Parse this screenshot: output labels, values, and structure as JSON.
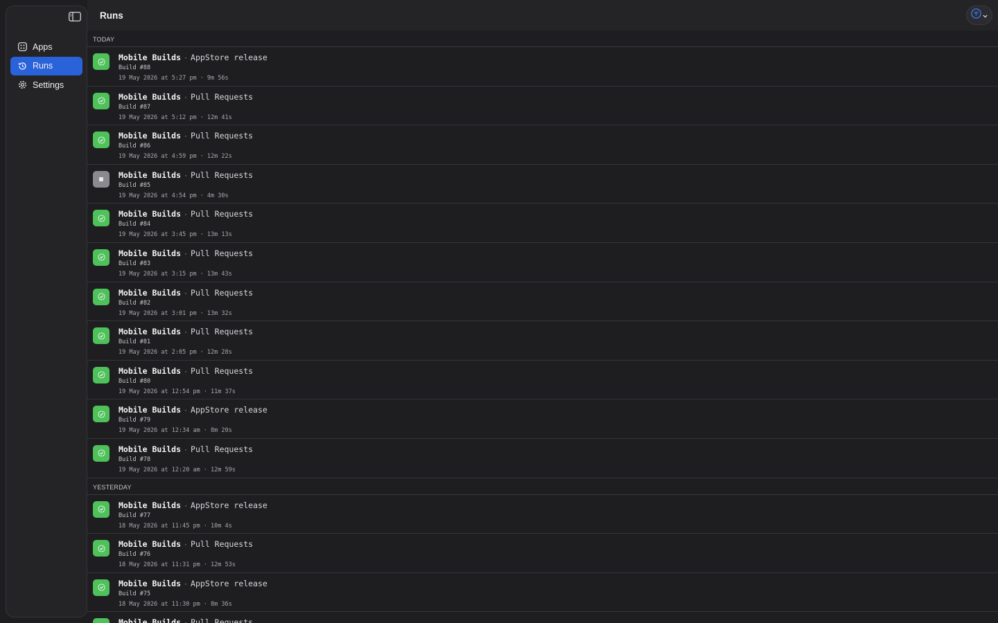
{
  "sidebar": {
    "items": [
      {
        "label": "Apps",
        "icon": "apps-icon"
      },
      {
        "label": "Runs",
        "icon": "history-icon",
        "active": true
      },
      {
        "label": "Settings",
        "icon": "gear-icon"
      }
    ]
  },
  "header": {
    "title": "Runs"
  },
  "colors": {
    "accent": "#2962d9",
    "success": "#4fc15a",
    "cancelled": "#8a8a8f"
  },
  "sections": [
    {
      "label": "TODAY",
      "runs": [
        {
          "app": "Mobile Builds",
          "sep": "·",
          "workflow": "AppStore release",
          "build": "Build #88",
          "meta": "19 May 2026 at 5:27 pm · 9m 56s",
          "status": "success"
        },
        {
          "app": "Mobile Builds",
          "sep": "·",
          "workflow": "Pull Requests",
          "build": "Build #87",
          "meta": "19 May 2026 at 5:12 pm · 12m 41s",
          "status": "success"
        },
        {
          "app": "Mobile Builds",
          "sep": "·",
          "workflow": "Pull Requests",
          "build": "Build #86",
          "meta": "19 May 2026 at 4:59 pm · 12m 22s",
          "status": "success"
        },
        {
          "app": "Mobile Builds",
          "sep": "·",
          "workflow": "Pull Requests",
          "build": "Build #85",
          "meta": "19 May 2026 at 4:54 pm · 4m 30s",
          "status": "cancelled"
        },
        {
          "app": "Mobile Builds",
          "sep": "·",
          "workflow": "Pull Requests",
          "build": "Build #84",
          "meta": "19 May 2026 at 3:45 pm · 13m 13s",
          "status": "success"
        },
        {
          "app": "Mobile Builds",
          "sep": "·",
          "workflow": "Pull Requests",
          "build": "Build #83",
          "meta": "19 May 2026 at 3:15 pm · 13m 43s",
          "status": "success"
        },
        {
          "app": "Mobile Builds",
          "sep": "·",
          "workflow": "Pull Requests",
          "build": "Build #82",
          "meta": "19 May 2026 at 3:01 pm · 13m 32s",
          "status": "success"
        },
        {
          "app": "Mobile Builds",
          "sep": "·",
          "workflow": "Pull Requests",
          "build": "Build #81",
          "meta": "19 May 2026 at 2:05 pm · 12m 28s",
          "status": "success"
        },
        {
          "app": "Mobile Builds",
          "sep": "·",
          "workflow": "Pull Requests",
          "build": "Build #80",
          "meta": "19 May 2026 at 12:54 pm · 11m 37s",
          "status": "success"
        },
        {
          "app": "Mobile Builds",
          "sep": "·",
          "workflow": "AppStore release",
          "build": "Build #79",
          "meta": "19 May 2026 at 12:34 am · 8m 20s",
          "status": "success"
        },
        {
          "app": "Mobile Builds",
          "sep": "·",
          "workflow": "Pull Requests",
          "build": "Build #78",
          "meta": "19 May 2026 at 12:20 am · 12m 59s",
          "status": "success"
        }
      ]
    },
    {
      "label": "YESTERDAY",
      "runs": [
        {
          "app": "Mobile Builds",
          "sep": "·",
          "workflow": "AppStore release",
          "build": "Build #77",
          "meta": "18 May 2026 at 11:45 pm · 10m 4s",
          "status": "success"
        },
        {
          "app": "Mobile Builds",
          "sep": "·",
          "workflow": "Pull Requests",
          "build": "Build #76",
          "meta": "18 May 2026 at 11:31 pm · 12m 53s",
          "status": "success"
        },
        {
          "app": "Mobile Builds",
          "sep": "·",
          "workflow": "AppStore release",
          "build": "Build #75",
          "meta": "18 May 2026 at 11:30 pm · 8m 36s",
          "status": "success"
        },
        {
          "app": "Mobile Builds",
          "sep": "·",
          "workflow": "Pull Requests",
          "build": "",
          "meta": "",
          "status": "success"
        }
      ]
    }
  ]
}
